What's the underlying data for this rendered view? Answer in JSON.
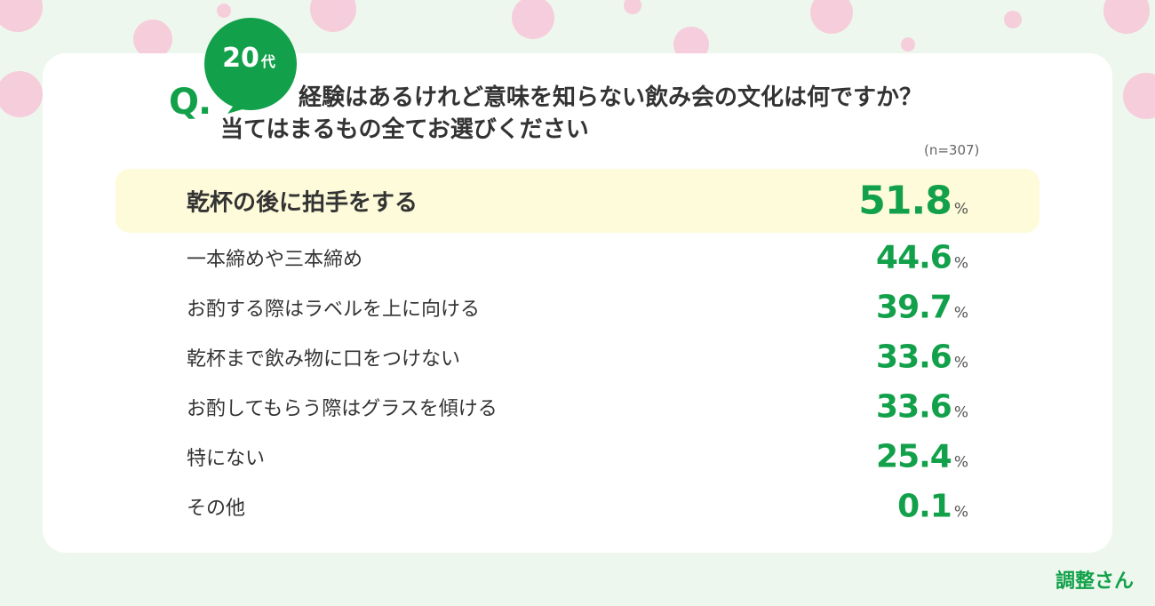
{
  "header": {
    "q_mark": "Q.",
    "age_number": "20",
    "age_suffix": "代",
    "question_line1": "経験はあるけれど意味を知らない飲み会の文化は何ですか？",
    "question_line2": "当てはまるもの全てお選びください",
    "sample_size": "(n=307)"
  },
  "brand": {
    "logo_text": "調整さん"
  },
  "colors": {
    "accent": "#12a14a",
    "highlight": "#fdfbd9",
    "background": "#eef7ee",
    "petal": "#f7c6d8"
  },
  "chart_data": {
    "type": "table",
    "title": "経験はあるけれど意味を知らない飲み会の文化は何ですか？当てはまるもの全てお選びください",
    "unit": "%",
    "rows": [
      {
        "label": "乾杯の後に拍手をする",
        "value": "51.8",
        "unit": "%"
      },
      {
        "label": "一本締めや三本締め",
        "value": "44.6",
        "unit": "%"
      },
      {
        "label": "お酌する際はラベルを上に向ける",
        "value": "39.7",
        "unit": "%"
      },
      {
        "label": "乾杯まで飲み物に口をつけない",
        "value": "33.6",
        "unit": "%"
      },
      {
        "label": "お酌してもらう際はグラスを傾ける",
        "value": "33.6",
        "unit": "%"
      },
      {
        "label": "特にない",
        "value": "25.4",
        "unit": "%"
      },
      {
        "label": "その他",
        "value": "0.1",
        "unit": "%"
      }
    ]
  }
}
